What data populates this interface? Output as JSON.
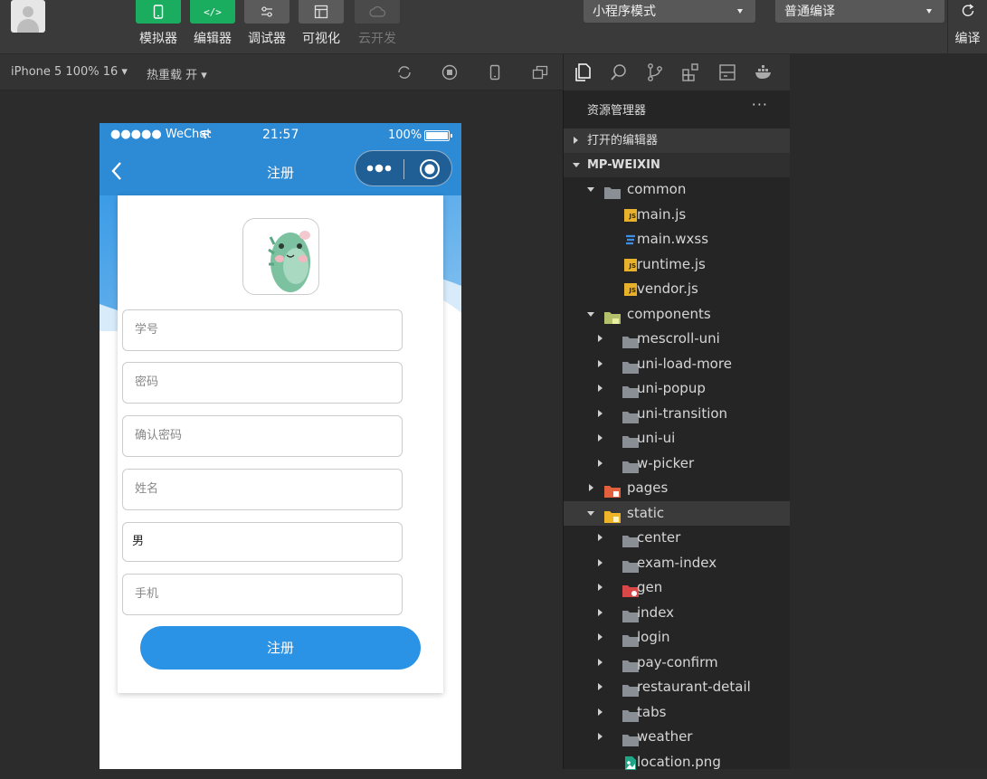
{
  "toolbar": {
    "tools": [
      {
        "label": "模拟器",
        "icon": "phone-icon"
      },
      {
        "label": "编辑器",
        "icon": "code-icon",
        "glyph": "</>"
      },
      {
        "label": "调试器",
        "icon": "debug-icon"
      },
      {
        "label": "可视化",
        "icon": "layout-icon"
      },
      {
        "label": "云开发",
        "icon": "cloud-icon"
      }
    ],
    "mode_select": "小程序模式",
    "compile_select": "普通编译",
    "compile_label": "编译"
  },
  "subbar": {
    "device": "iPhone 5 100% 16",
    "hot_reload": "热重载 开"
  },
  "phone": {
    "status": {
      "carrier": "●●●●● WeChat",
      "time": "21:57",
      "battery": "100%"
    },
    "nav_title": "注册",
    "fields": [
      {
        "placeholder": "学号",
        "kind": "placeholder"
      },
      {
        "placeholder": "密码",
        "kind": "placeholder"
      },
      {
        "placeholder": "确认密码",
        "kind": "placeholder"
      },
      {
        "placeholder": "姓名",
        "kind": "placeholder"
      },
      {
        "value": "男",
        "kind": "value"
      },
      {
        "placeholder": "手机",
        "kind": "placeholder"
      }
    ],
    "submit_label": "注册"
  },
  "explorer": {
    "title": "资源管理器",
    "more": "···",
    "open_editors": "打开的编辑器",
    "project": "MP-WEIXIN",
    "tree": [
      {
        "label": "common",
        "depth": 1,
        "kind": "folder-open",
        "expanded": true
      },
      {
        "label": "main.js",
        "depth": 2,
        "kind": "js"
      },
      {
        "label": "main.wxss",
        "depth": 2,
        "kind": "css"
      },
      {
        "label": "runtime.js",
        "depth": 2,
        "kind": "js"
      },
      {
        "label": "vendor.js",
        "depth": 2,
        "kind": "js"
      },
      {
        "label": "components",
        "depth": 1,
        "kind": "folder-components",
        "expanded": true
      },
      {
        "label": "mescroll-uni",
        "depth": 2,
        "kind": "folder"
      },
      {
        "label": "uni-load-more",
        "depth": 2,
        "kind": "folder"
      },
      {
        "label": "uni-popup",
        "depth": 2,
        "kind": "folder"
      },
      {
        "label": "uni-transition",
        "depth": 2,
        "kind": "folder"
      },
      {
        "label": "uni-ui",
        "depth": 2,
        "kind": "folder"
      },
      {
        "label": "w-picker",
        "depth": 2,
        "kind": "folder"
      },
      {
        "label": "pages",
        "depth": 1,
        "kind": "folder-pages"
      },
      {
        "label": "static",
        "depth": 1,
        "kind": "folder-static",
        "expanded": true,
        "selected": true
      },
      {
        "label": "center",
        "depth": 2,
        "kind": "folder"
      },
      {
        "label": "exam-index",
        "depth": 2,
        "kind": "folder"
      },
      {
        "label": "gen",
        "depth": 2,
        "kind": "folder-gen"
      },
      {
        "label": "index",
        "depth": 2,
        "kind": "folder"
      },
      {
        "label": "login",
        "depth": 2,
        "kind": "folder"
      },
      {
        "label": "pay-confirm",
        "depth": 2,
        "kind": "folder"
      },
      {
        "label": "restaurant-detail",
        "depth": 2,
        "kind": "folder"
      },
      {
        "label": "tabs",
        "depth": 2,
        "kind": "folder"
      },
      {
        "label": "weather",
        "depth": 2,
        "kind": "folder"
      },
      {
        "label": "location.png",
        "depth": 2,
        "kind": "image"
      }
    ]
  }
}
